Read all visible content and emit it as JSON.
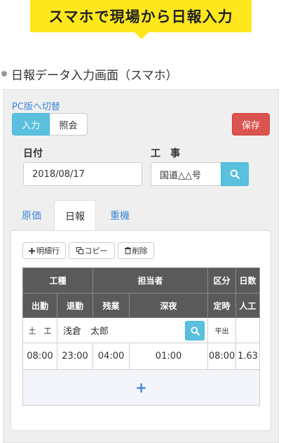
{
  "banner": {
    "title": "スマホで現場から日報入力"
  },
  "section": {
    "title": "日報データ入力画面（スマホ）"
  },
  "panel": {
    "pc_link": "PC版へ切替",
    "mode_tabs": [
      {
        "label": "入力",
        "active": true
      },
      {
        "label": "照会",
        "active": false
      }
    ],
    "save_label": "保存",
    "date": {
      "label": "日付",
      "value": "2018/08/17"
    },
    "site": {
      "label": "工　事",
      "value": "国道△△号"
    }
  },
  "tabs": [
    {
      "label": "原価",
      "active": false
    },
    {
      "label": "日報",
      "active": true
    },
    {
      "label": "重機",
      "active": false
    }
  ],
  "toolbar": {
    "add_row": {
      "icon": "plus-icon",
      "label": "明細行"
    },
    "copy": {
      "icon": "copy-icon",
      "label": "コピー"
    },
    "delete": {
      "icon": "trash-icon",
      "label": "削除"
    }
  },
  "grid": {
    "header1": {
      "kind": "工種",
      "person": "担当者",
      "division": "区分",
      "days": "日数"
    },
    "header2": {
      "start": "出勤",
      "leave": "退勤",
      "overtime": "残業",
      "night": "深夜",
      "regular": "定時",
      "labor": "人工"
    },
    "row": {
      "kind": "土　工",
      "person": "浅倉　太郎",
      "division": "平出",
      "days": "",
      "start": "08:00",
      "leave": "23:00",
      "overtime": "04:00",
      "night": "01:00",
      "regular": "08:00",
      "labor": "1.63"
    },
    "add_icon": "plus-icon",
    "add_label": "+"
  },
  "colors": {
    "banner": "#ffe71e",
    "accent": "#5bc0de",
    "danger": "#d9534f",
    "link": "#3b87d8",
    "header": "#5a5a5a"
  }
}
